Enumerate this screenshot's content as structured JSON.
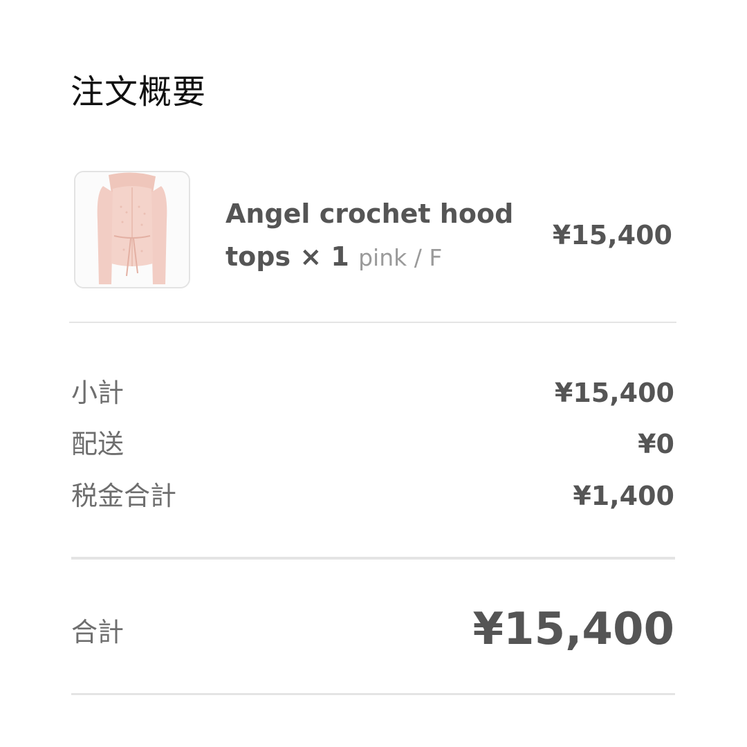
{
  "summary": {
    "title": "注文概要"
  },
  "item": {
    "image_icon": "product-image-pink-hooded-cardigan",
    "name": "Angel crochet hood tops × 1",
    "variant": "pink / F",
    "price": "¥15,400",
    "image_color": "#f2cdc4"
  },
  "breakdown": [
    {
      "label": "小計",
      "value": "¥15,400"
    },
    {
      "label": "配送",
      "value": "¥0"
    },
    {
      "label": "税金合計",
      "value": "¥1,400"
    }
  ],
  "total": {
    "label": "合計",
    "value": "¥15,400"
  },
  "colors": {
    "title": "#111111",
    "text_bold": "#555555",
    "text_muted": "#6e6e6e",
    "variant": "#9a9a9a",
    "divider": "#e4e4e4"
  }
}
